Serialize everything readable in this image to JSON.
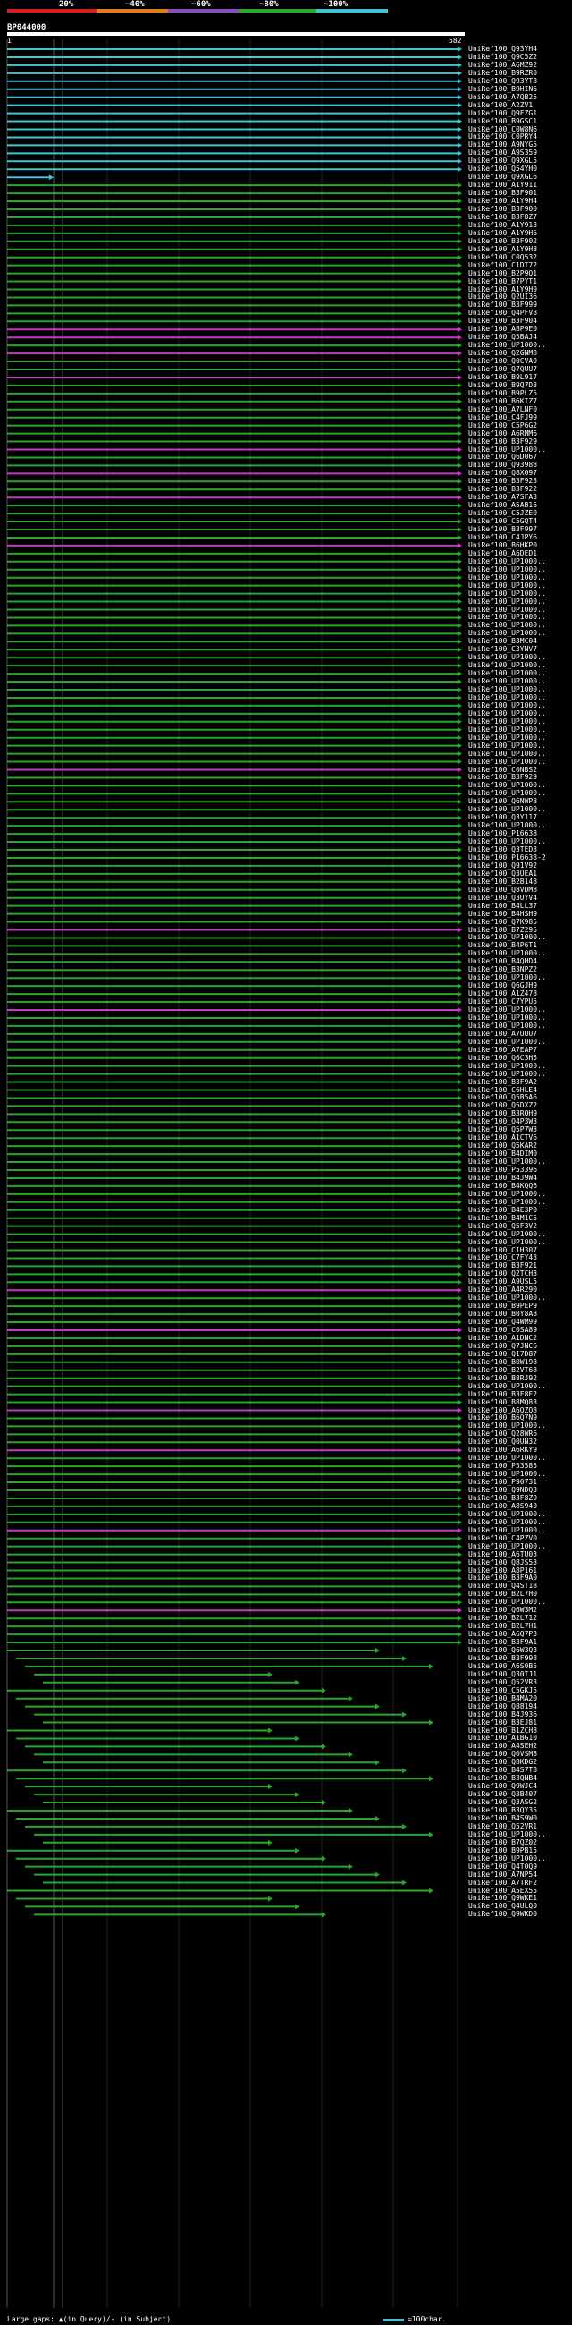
{
  "scale": {
    "labels": [
      "20%",
      "~40%",
      "~60%",
      "~80%",
      "~100%"
    ],
    "colors": [
      "#d62020",
      "#e07e1c",
      "#8a4ec0",
      "#2aa62a",
      "#3fc6d6"
    ]
  },
  "query": {
    "name": "BP044000",
    "start": "1",
    "end": "582"
  },
  "colors": {
    "cyan": "#3fc6d6",
    "green": "#2aa62a",
    "magenta": "#c43ac4",
    "white": "#ffffff",
    "gray": "#333333"
  },
  "hits": [
    "UniRef100_Q93YH4",
    "UniRef100_Q9C5Z2",
    "UniRef100_A6MZ92",
    "UniRef100_B9RZR0",
    "UniRef100_Q93YT8",
    "UniRef100_B9HIN6",
    "UniRef100_A7QB25",
    "UniRef100_A2ZV1",
    "UniRef100_Q9FZG1",
    "UniRef100_B9GSC1",
    "UniRef100_C0W8N6",
    "UniRef100_C0PRY4",
    "UniRef100_A9NYG5",
    "UniRef100_A9S359",
    "UniRef100_Q9XGL5",
    "UniRef100_Q54YH0",
    "UniRef100_Q9XGL6",
    "UniRef100_A1Y911",
    "UniRef100_B3F901",
    "UniRef100_A1Y9H4",
    "UniRef100_B3F900",
    "UniRef100_B3F8Z7",
    "UniRef100_A1Y913",
    "UniRef100_A1Y9H6",
    "UniRef100_B3F902",
    "UniRef100_A1Y9H8",
    "UniRef100_C0Q532",
    "UniRef100_C1DT72",
    "UniRef100_B2P9Q1",
    "UniRef100_B7PYT1",
    "UniRef100_A1Y9H9",
    "UniRef100_Q2UI36",
    "UniRef100_B3F999",
    "UniRef100_Q4PFV8",
    "UniRef100_B3F904",
    "UniRef100_A8P9E0",
    "UniRef100_Q5BAJ4",
    "UniRef100_UP1000..",
    "UniRef100_Q2GNM8",
    "UniRef100_Q0CVA9",
    "UniRef100_Q7QUU7",
    "UniRef100_B9L917",
    "UniRef100_B9Q7D3",
    "UniRef100_B9PLZ5",
    "UniRef100_B6KIZ7",
    "UniRef100_A7LNF0",
    "UniRef100_C4FJ99",
    "UniRef100_C5P6G2",
    "UniRef100_A6RMM6",
    "UniRef100_B3F929",
    "UniRef100_UP1000..",
    "UniRef100_Q6D067",
    "UniRef100_Q93988",
    "UniRef100_Q8X097",
    "UniRef100_B3F923",
    "UniRef100_B3F922",
    "UniRef100_A7SFA3",
    "UniRef100_A5AB16",
    "UniRef100_C5JZE0",
    "UniRef100_C5GQT4",
    "UniRef100_B3F997",
    "UniRef100_C4JPY6",
    "UniRef100_B6HKP0",
    "UniRef100_A6DED1",
    "UniRef100_UP1000..",
    "UniRef100_UP1000..",
    "UniRef100_UP1000..",
    "UniRef100_UP1000..",
    "UniRef100_UP1000..",
    "UniRef100_UP1000..",
    "UniRef100_UP1000..",
    "UniRef100_UP1000..",
    "UniRef100_UP1000..",
    "UniRef100_UP1000..",
    "UniRef100_B3MC04",
    "UniRef100_C3YNV7",
    "UniRef100_UP1000..",
    "UniRef100_UP1000..",
    "UniRef100_UP1000..",
    "UniRef100_UP1000..",
    "UniRef100_UP1000..",
    "UniRef100_UP1000..",
    "UniRef100_UP1000..",
    "UniRef100_UP1000..",
    "UniRef100_UP1000..",
    "UniRef100_UP1000..",
    "UniRef100_UP1000..",
    "UniRef100_UP1000..",
    "UniRef100_UP1000..",
    "UniRef100_UP1000..",
    "UniRef100_C0NBS2",
    "UniRef100_B3F929",
    "UniRef100_UP1000..",
    "UniRef100_UP1000..",
    "UniRef100_Q6NWP8",
    "UniRef100_UP1000..",
    "UniRef100_Q3Y117",
    "UniRef100_UP1000..",
    "UniRef100_P16638",
    "UniRef100_UP1000..",
    "UniRef100_Q3TED3",
    "UniRef100_P16638-2",
    "UniRef100_Q91V92",
    "UniRef100_Q3UEA1",
    "UniRef100_B2B148",
    "UniRef100_Q8VDM8",
    "UniRef100_Q3UYV4",
    "UniRef100_B4LL37",
    "UniRef100_B4HSH9",
    "UniRef100_Q7K985",
    "UniRef100_B7Z295",
    "UniRef100_UP1000..",
    "UniRef100_B4P6T1",
    "UniRef100_UP1000..",
    "UniRef100_B4QHD4",
    "UniRef100_B3NPZ2",
    "UniRef100_UP1000..",
    "UniRef100_Q6GJH9",
    "UniRef100_A1Z478",
    "UniRef100_C7YPU5",
    "UniRef100_UP1000..",
    "UniRef100_UP1000..",
    "UniRef100_UP1000..",
    "UniRef100_A7UUU7",
    "UniRef100_UP1000..",
    "UniRef100_A7EAP7",
    "UniRef100_Q6C3H5",
    "UniRef100_UP1000..",
    "UniRef100_UP1000..",
    "UniRef100_B3F9A2",
    "UniRef100_C6HLE4",
    "UniRef100_Q5B5A6",
    "UniRef100_Q5DXZ2",
    "UniRef100_B3RQH9",
    "UniRef100_Q4P3W3",
    "UniRef100_Q5P7W3",
    "UniRef100_A1CTV6",
    "UniRef100_Q5KAR2",
    "UniRef100_B4DIM0",
    "UniRef100_UP1000..",
    "UniRef100_P53396",
    "UniRef100_B4J9W4",
    "UniRef100_B4KQQ6",
    "UniRef100_UP1000..",
    "UniRef100_UP1000..",
    "UniRef100_B4E3P0",
    "UniRef100_B4M1C5",
    "UniRef100_Q5F3V2",
    "UniRef100_UP1000..",
    "UniRef100_UP1000..",
    "UniRef100_C1H307",
    "UniRef100_C7FY43",
    "UniRef100_B3F921",
    "UniRef100_Q2TCH3",
    "UniRef100_A9USL5",
    "UniRef100_A4R290",
    "UniRef100_UP1000..",
    "UniRef100_B9PEP9",
    "UniRef100_B0Y8A8",
    "UniRef100_Q4WM99",
    "UniRef100_C0SA89",
    "UniRef100_A1DNC2",
    "UniRef100_Q7JNC6",
    "UniRef100_Q17D87",
    "UniRef100_B0W198",
    "UniRef100_B2VT68",
    "UniRef100_B8RJ92",
    "UniRef100_UP1000..",
    "UniRef100_B3F8F2",
    "UniRef100_B8MQ83",
    "UniRef100_A6QZQ8",
    "UniRef100_B6Q7N9",
    "UniRef100_UP1000..",
    "UniRef100_Q28WR6",
    "UniRef100_Q0UN32",
    "UniRef100_A6RKY9",
    "UniRef100_UP1000..",
    "UniRef100_P53585",
    "UniRef100_UP1000..",
    "UniRef100_P90731",
    "UniRef100_Q9NDQ3",
    "UniRef100_B3F8Z9",
    "UniRef100_A8S940",
    "UniRef100_UP1000..",
    "UniRef100_UP1000..",
    "UniRef100_UP1000..",
    "UniRef100_C4PZV0",
    "UniRef100_UP1000..",
    "UniRef100_A6TU03",
    "UniRef100_Q8JS53",
    "UniRef100_A8P161",
    "UniRef100_B3F9A0",
    "UniRef100_Q4ST18",
    "UniRef100_B2L7H0",
    "UniRef100_UP1000..",
    "UniRef100_Q6W3M2",
    "UniRef100_B2L712",
    "UniRef100_B2L7H1",
    "UniRef100_A6Q7P3",
    "UniRef100_B3F9A1",
    "UniRef100_Q6W3Q3",
    "UniRef100_B3F998",
    "UniRef100_A6S0B5",
    "UniRef100_Q30TJ1",
    "UniRef100_Q52VR3",
    "UniRef100_C5GKJ5",
    "UniRef100_B4MA20",
    "UniRef100_Q88194",
    "UniRef100_B4J936",
    "UniRef100_B3EJ81",
    "UniRef100_B1ZCH8",
    "UniRef100_A1BG10",
    "UniRef100_A4SEH2",
    "UniRef100_Q0VSM8",
    "UniRef100_Q8KDG2",
    "UniRef100_B4S7T8",
    "UniRef100_B3QNB4",
    "UniRef100_Q9WJC4",
    "UniRef100_Q3B407",
    "UniRef100_Q3ASG2",
    "UniRef100_B3QY35",
    "UniRef100_B4S9W0",
    "UniRef100_Q52VR1",
    "UniRef100_UP1000..",
    "UniRef100_B7QZ02",
    "UniRef100_B9PB15",
    "UniRef100_UP1000..",
    "UniRef100_Q4T0Q9",
    "UniRef100_A7NP54",
    "UniRef100_A7TRF2",
    "UniRef100_A5EX55",
    "UniRef100_Q9WKE1",
    "UniRef100_Q4ULQ0",
    "UniRef100_Q9WKD0"
  ],
  "footer": {
    "left": "Large gaps: ▲(in Query)/- (in Subject)",
    "right": "=100char."
  }
}
